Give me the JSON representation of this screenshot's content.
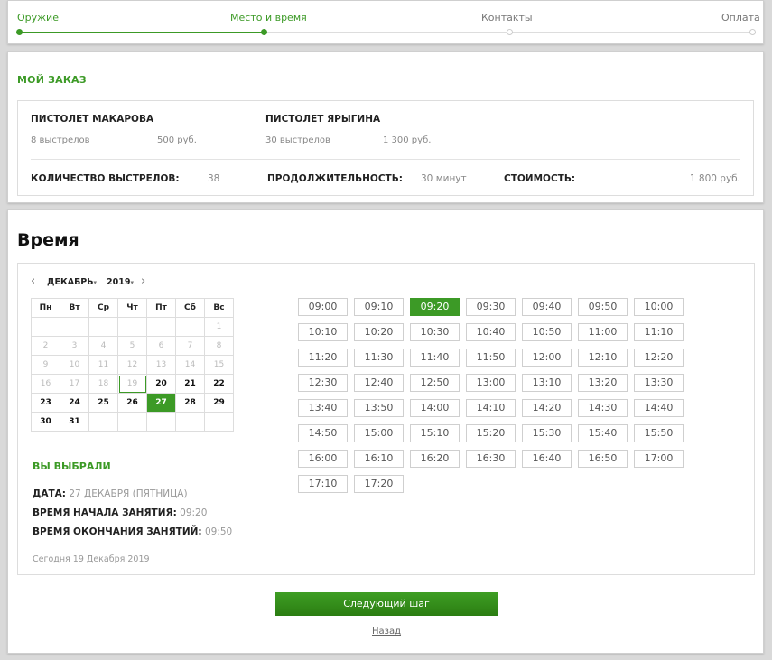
{
  "progress": {
    "steps": [
      {
        "label": "Оружие",
        "state": "done"
      },
      {
        "label": "Место и время",
        "state": "done"
      },
      {
        "label": "Контакты",
        "state": "todo"
      },
      {
        "label": "Оплата",
        "state": "todo"
      }
    ]
  },
  "order": {
    "title": "МОЙ ЗАКАЗ",
    "weapons": [
      {
        "name": "ПИСТОЛЕТ МАКАРОВА",
        "shots": "8 выстрелов",
        "price": "500 руб."
      },
      {
        "name": "ПИСТОЛЕТ ЯРЫГИНА",
        "shots": "30 выстрелов",
        "price": "1 300 руб."
      }
    ],
    "summary": {
      "shots_label": "КОЛИЧЕСТВО ВЫСТРЕЛОВ:",
      "shots_value": "38",
      "duration_label": "ПРОДОЛЖИТЕЛЬНОСТЬ:",
      "duration_value": "30 минут",
      "cost_label": "СТОИМОСТЬ:",
      "cost_value": "1 800 руб."
    }
  },
  "time": {
    "title": "Время",
    "calendar": {
      "prev_arrow": "‹",
      "next_arrow": "›",
      "month": "ДЕКАБРЬ",
      "year": "2019",
      "caret": "▾",
      "weekdays": [
        "Пн",
        "Вт",
        "Ср",
        "Чт",
        "Пт",
        "Сб",
        "Вс"
      ],
      "weeks": [
        [
          "",
          "",
          "",
          "",
          "",
          "",
          "1"
        ],
        [
          "2",
          "3",
          "4",
          "5",
          "6",
          "7",
          "8"
        ],
        [
          "9",
          "10",
          "11",
          "12",
          "13",
          "14",
          "15"
        ],
        [
          "16",
          "17",
          "18",
          "19",
          "20",
          "21",
          "22"
        ],
        [
          "23",
          "24",
          "25",
          "26",
          "27",
          "28",
          "29"
        ],
        [
          "30",
          "31",
          "",
          "",
          "",
          "",
          ""
        ]
      ],
      "today": "19",
      "selected": "27",
      "first_available": 20
    },
    "chosen": {
      "title": "ВЫ ВЫБРАЛИ",
      "date_label": "ДАТА:",
      "date_value": "27 ДЕКАБРЯ (ПЯТНИЦА)",
      "start_label": "ВРЕМЯ НАЧАЛА ЗАНЯТИЯ:",
      "start_value": "09:20",
      "end_label": "ВРЕМЯ ОКОНЧАНИЯ ЗАНЯТИЙ:",
      "end_value": "09:50"
    },
    "today_note": "Сегодня 19 Декабря 2019",
    "slots": [
      "09:00",
      "09:10",
      "09:20",
      "09:30",
      "09:40",
      "09:50",
      "10:00",
      "10:10",
      "10:20",
      "10:30",
      "10:40",
      "10:50",
      "11:00",
      "11:10",
      "11:20",
      "11:30",
      "11:40",
      "11:50",
      "12:00",
      "12:10",
      "12:20",
      "12:30",
      "12:40",
      "12:50",
      "13:00",
      "13:10",
      "13:20",
      "13:30",
      "13:40",
      "13:50",
      "14:00",
      "14:10",
      "14:20",
      "14:30",
      "14:40",
      "14:50",
      "15:00",
      "15:10",
      "15:20",
      "15:30",
      "15:40",
      "15:50",
      "16:00",
      "16:10",
      "16:20",
      "16:30",
      "16:40",
      "16:50",
      "17:00",
      "17:10",
      "17:20"
    ],
    "selected_slot": "09:20"
  },
  "actions": {
    "next_label": "Следующий шаг",
    "back_label": "Назад"
  },
  "colors": {
    "accent": "#3c9a26"
  }
}
